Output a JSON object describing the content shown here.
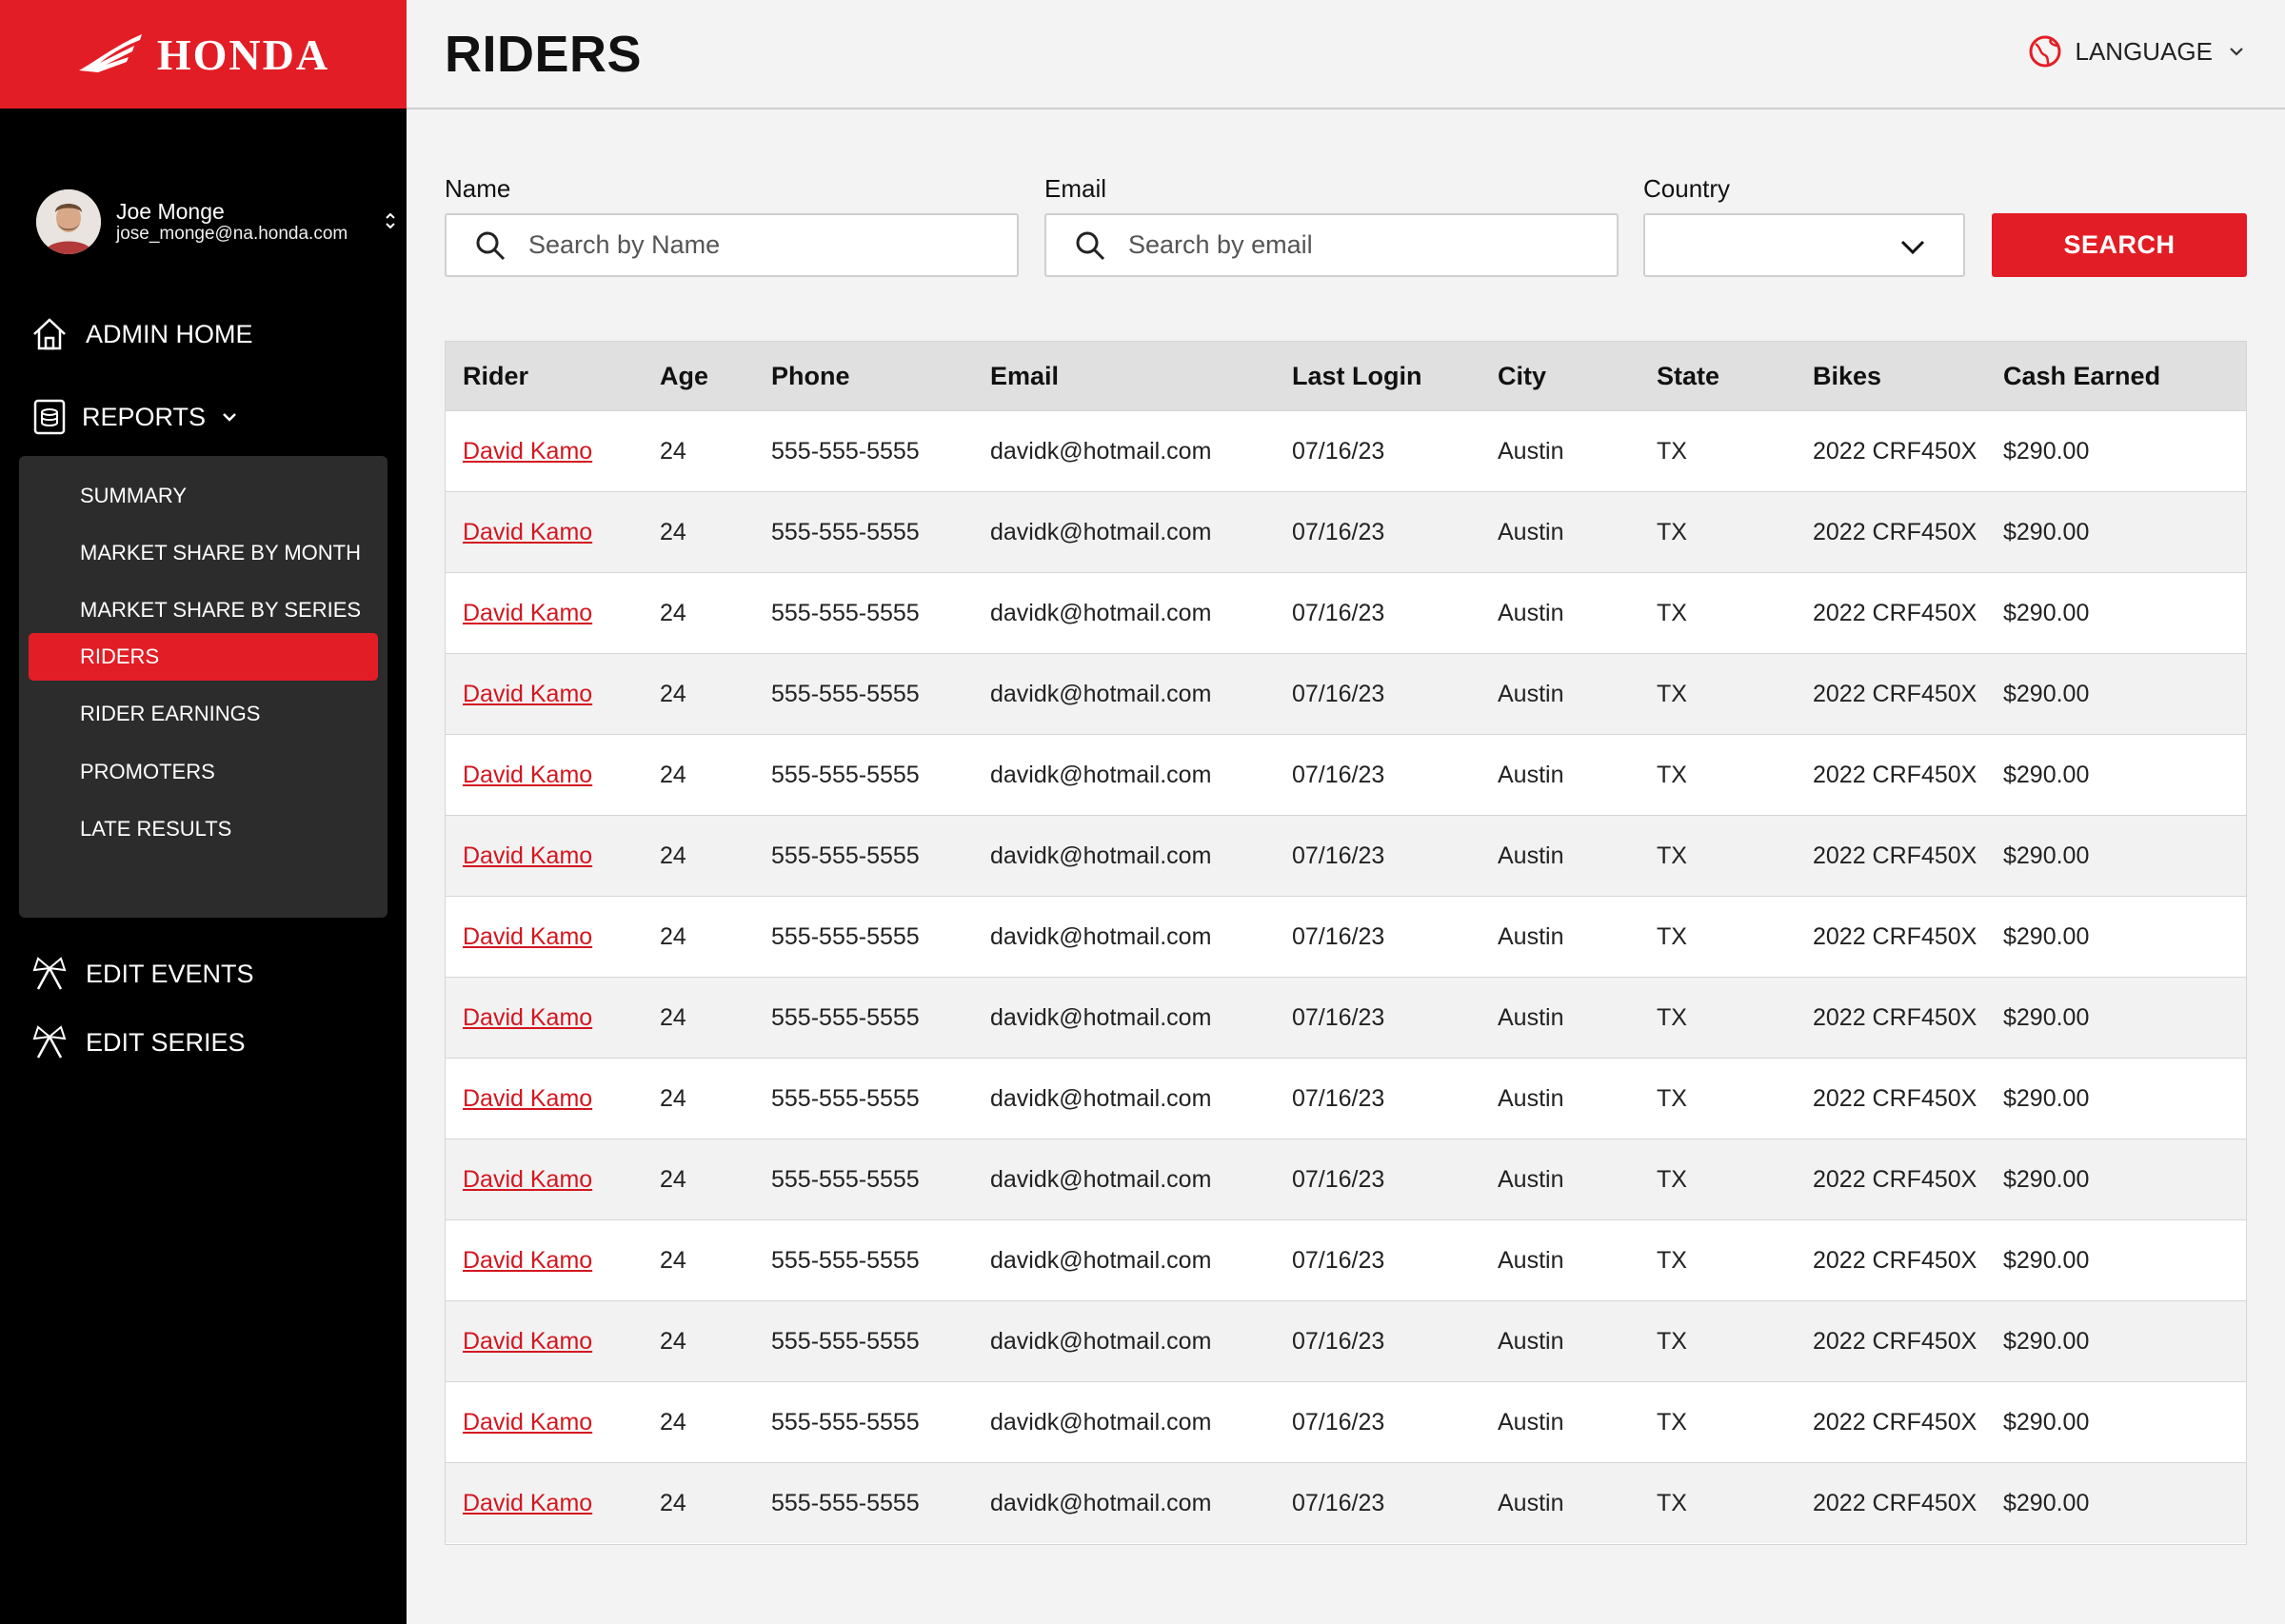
{
  "brand": {
    "name": "HONDA",
    "accent": "#e31d25"
  },
  "user": {
    "name": "Joe Monge",
    "email": "jose_monge@na.honda.com"
  },
  "nav": {
    "admin_home": "ADMIN HOME",
    "reports": "REPORTS",
    "reports_items": [
      {
        "label": "SUMMARY",
        "active": false
      },
      {
        "label": "MARKET SHARE BY MONTH",
        "active": false
      },
      {
        "label": "MARKET SHARE BY SERIES",
        "active": false
      },
      {
        "label": "RIDERS",
        "active": true
      },
      {
        "label": "RIDER EARNINGS",
        "active": false
      },
      {
        "label": "PROMOTERS",
        "active": false
      },
      {
        "label": "LATE RESULTS",
        "active": false
      }
    ],
    "edit_events": "EDIT EVENTS",
    "edit_series": "EDIT SERIES"
  },
  "header": {
    "title": "RIDERS",
    "language": "LANGUAGE"
  },
  "filters": {
    "name_label": "Name",
    "name_placeholder": "Search by Name",
    "email_label": "Email",
    "email_placeholder": "Search by email",
    "country_label": "Country",
    "country_value": "",
    "search_button": "SEARCH"
  },
  "table": {
    "columns": [
      "Rider",
      "Age",
      "Phone",
      "Email",
      "Last Login",
      "City",
      "State",
      "Bikes",
      "Cash Earned"
    ],
    "rows": [
      [
        "David Kamo",
        "24",
        "555-555-5555",
        "davidk@hotmail.com",
        "07/16/23",
        "Austin",
        "TX",
        "2022 CRF450X",
        "$290.00"
      ],
      [
        "David Kamo",
        "24",
        "555-555-5555",
        "davidk@hotmail.com",
        "07/16/23",
        "Austin",
        "TX",
        "2022 CRF450X",
        "$290.00"
      ],
      [
        "David Kamo",
        "24",
        "555-555-5555",
        "davidk@hotmail.com",
        "07/16/23",
        "Austin",
        "TX",
        "2022 CRF450X",
        "$290.00"
      ],
      [
        "David Kamo",
        "24",
        "555-555-5555",
        "davidk@hotmail.com",
        "07/16/23",
        "Austin",
        "TX",
        "2022 CRF450X",
        "$290.00"
      ],
      [
        "David Kamo",
        "24",
        "555-555-5555",
        "davidk@hotmail.com",
        "07/16/23",
        "Austin",
        "TX",
        "2022 CRF450X",
        "$290.00"
      ],
      [
        "David Kamo",
        "24",
        "555-555-5555",
        "davidk@hotmail.com",
        "07/16/23",
        "Austin",
        "TX",
        "2022 CRF450X",
        "$290.00"
      ],
      [
        "David Kamo",
        "24",
        "555-555-5555",
        "davidk@hotmail.com",
        "07/16/23",
        "Austin",
        "TX",
        "2022 CRF450X",
        "$290.00"
      ],
      [
        "David Kamo",
        "24",
        "555-555-5555",
        "davidk@hotmail.com",
        "07/16/23",
        "Austin",
        "TX",
        "2022 CRF450X",
        "$290.00"
      ],
      [
        "David Kamo",
        "24",
        "555-555-5555",
        "davidk@hotmail.com",
        "07/16/23",
        "Austin",
        "TX",
        "2022 CRF450X",
        "$290.00"
      ],
      [
        "David Kamo",
        "24",
        "555-555-5555",
        "davidk@hotmail.com",
        "07/16/23",
        "Austin",
        "TX",
        "2022 CRF450X",
        "$290.00"
      ],
      [
        "David Kamo",
        "24",
        "555-555-5555",
        "davidk@hotmail.com",
        "07/16/23",
        "Austin",
        "TX",
        "2022 CRF450X",
        "$290.00"
      ],
      [
        "David Kamo",
        "24",
        "555-555-5555",
        "davidk@hotmail.com",
        "07/16/23",
        "Austin",
        "TX",
        "2022 CRF450X",
        "$290.00"
      ],
      [
        "David Kamo",
        "24",
        "555-555-5555",
        "davidk@hotmail.com",
        "07/16/23",
        "Austin",
        "TX",
        "2022 CRF450X",
        "$290.00"
      ],
      [
        "David Kamo",
        "24",
        "555-555-5555",
        "davidk@hotmail.com",
        "07/16/23",
        "Austin",
        "TX",
        "2022 CRF450X",
        "$290.00"
      ]
    ]
  },
  "icons": {
    "logo": "honda-wing-icon",
    "home": "home-icon",
    "reports": "database-icon",
    "events": "checkered-flags-icon",
    "language": "globe-icon",
    "search": "search-icon"
  }
}
